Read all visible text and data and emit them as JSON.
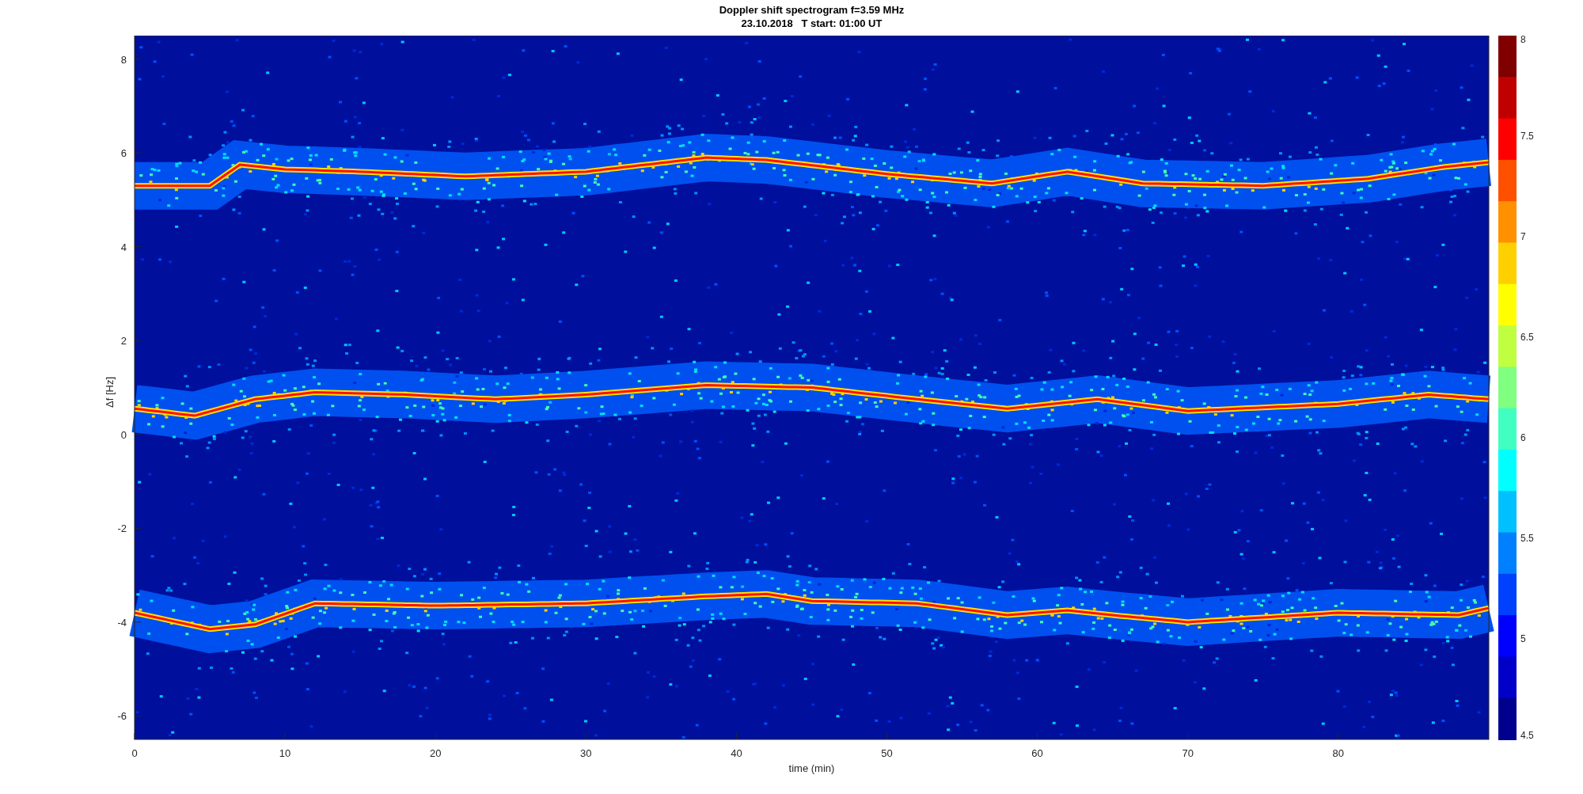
{
  "figure": {
    "title": "Doppler shift spectrogram f=3.59 MHz",
    "subtitle": "23.10.2018   T start: 01:00 UT"
  },
  "axes": {
    "ylabel": "Δf [Hz]",
    "xlabel": "time (min)",
    "yticks": [
      "8",
      "6",
      "4",
      "2",
      "0",
      "-2",
      "-4",
      "-6"
    ],
    "xticks": [
      "0",
      "10",
      "20",
      "30",
      "40",
      "50",
      "60",
      "70",
      "80"
    ]
  },
  "colorbar": {
    "ticks": [
      "8",
      "7.5",
      "7",
      "6.5",
      "6",
      "5.5",
      "5",
      "4.5"
    ]
  }
}
